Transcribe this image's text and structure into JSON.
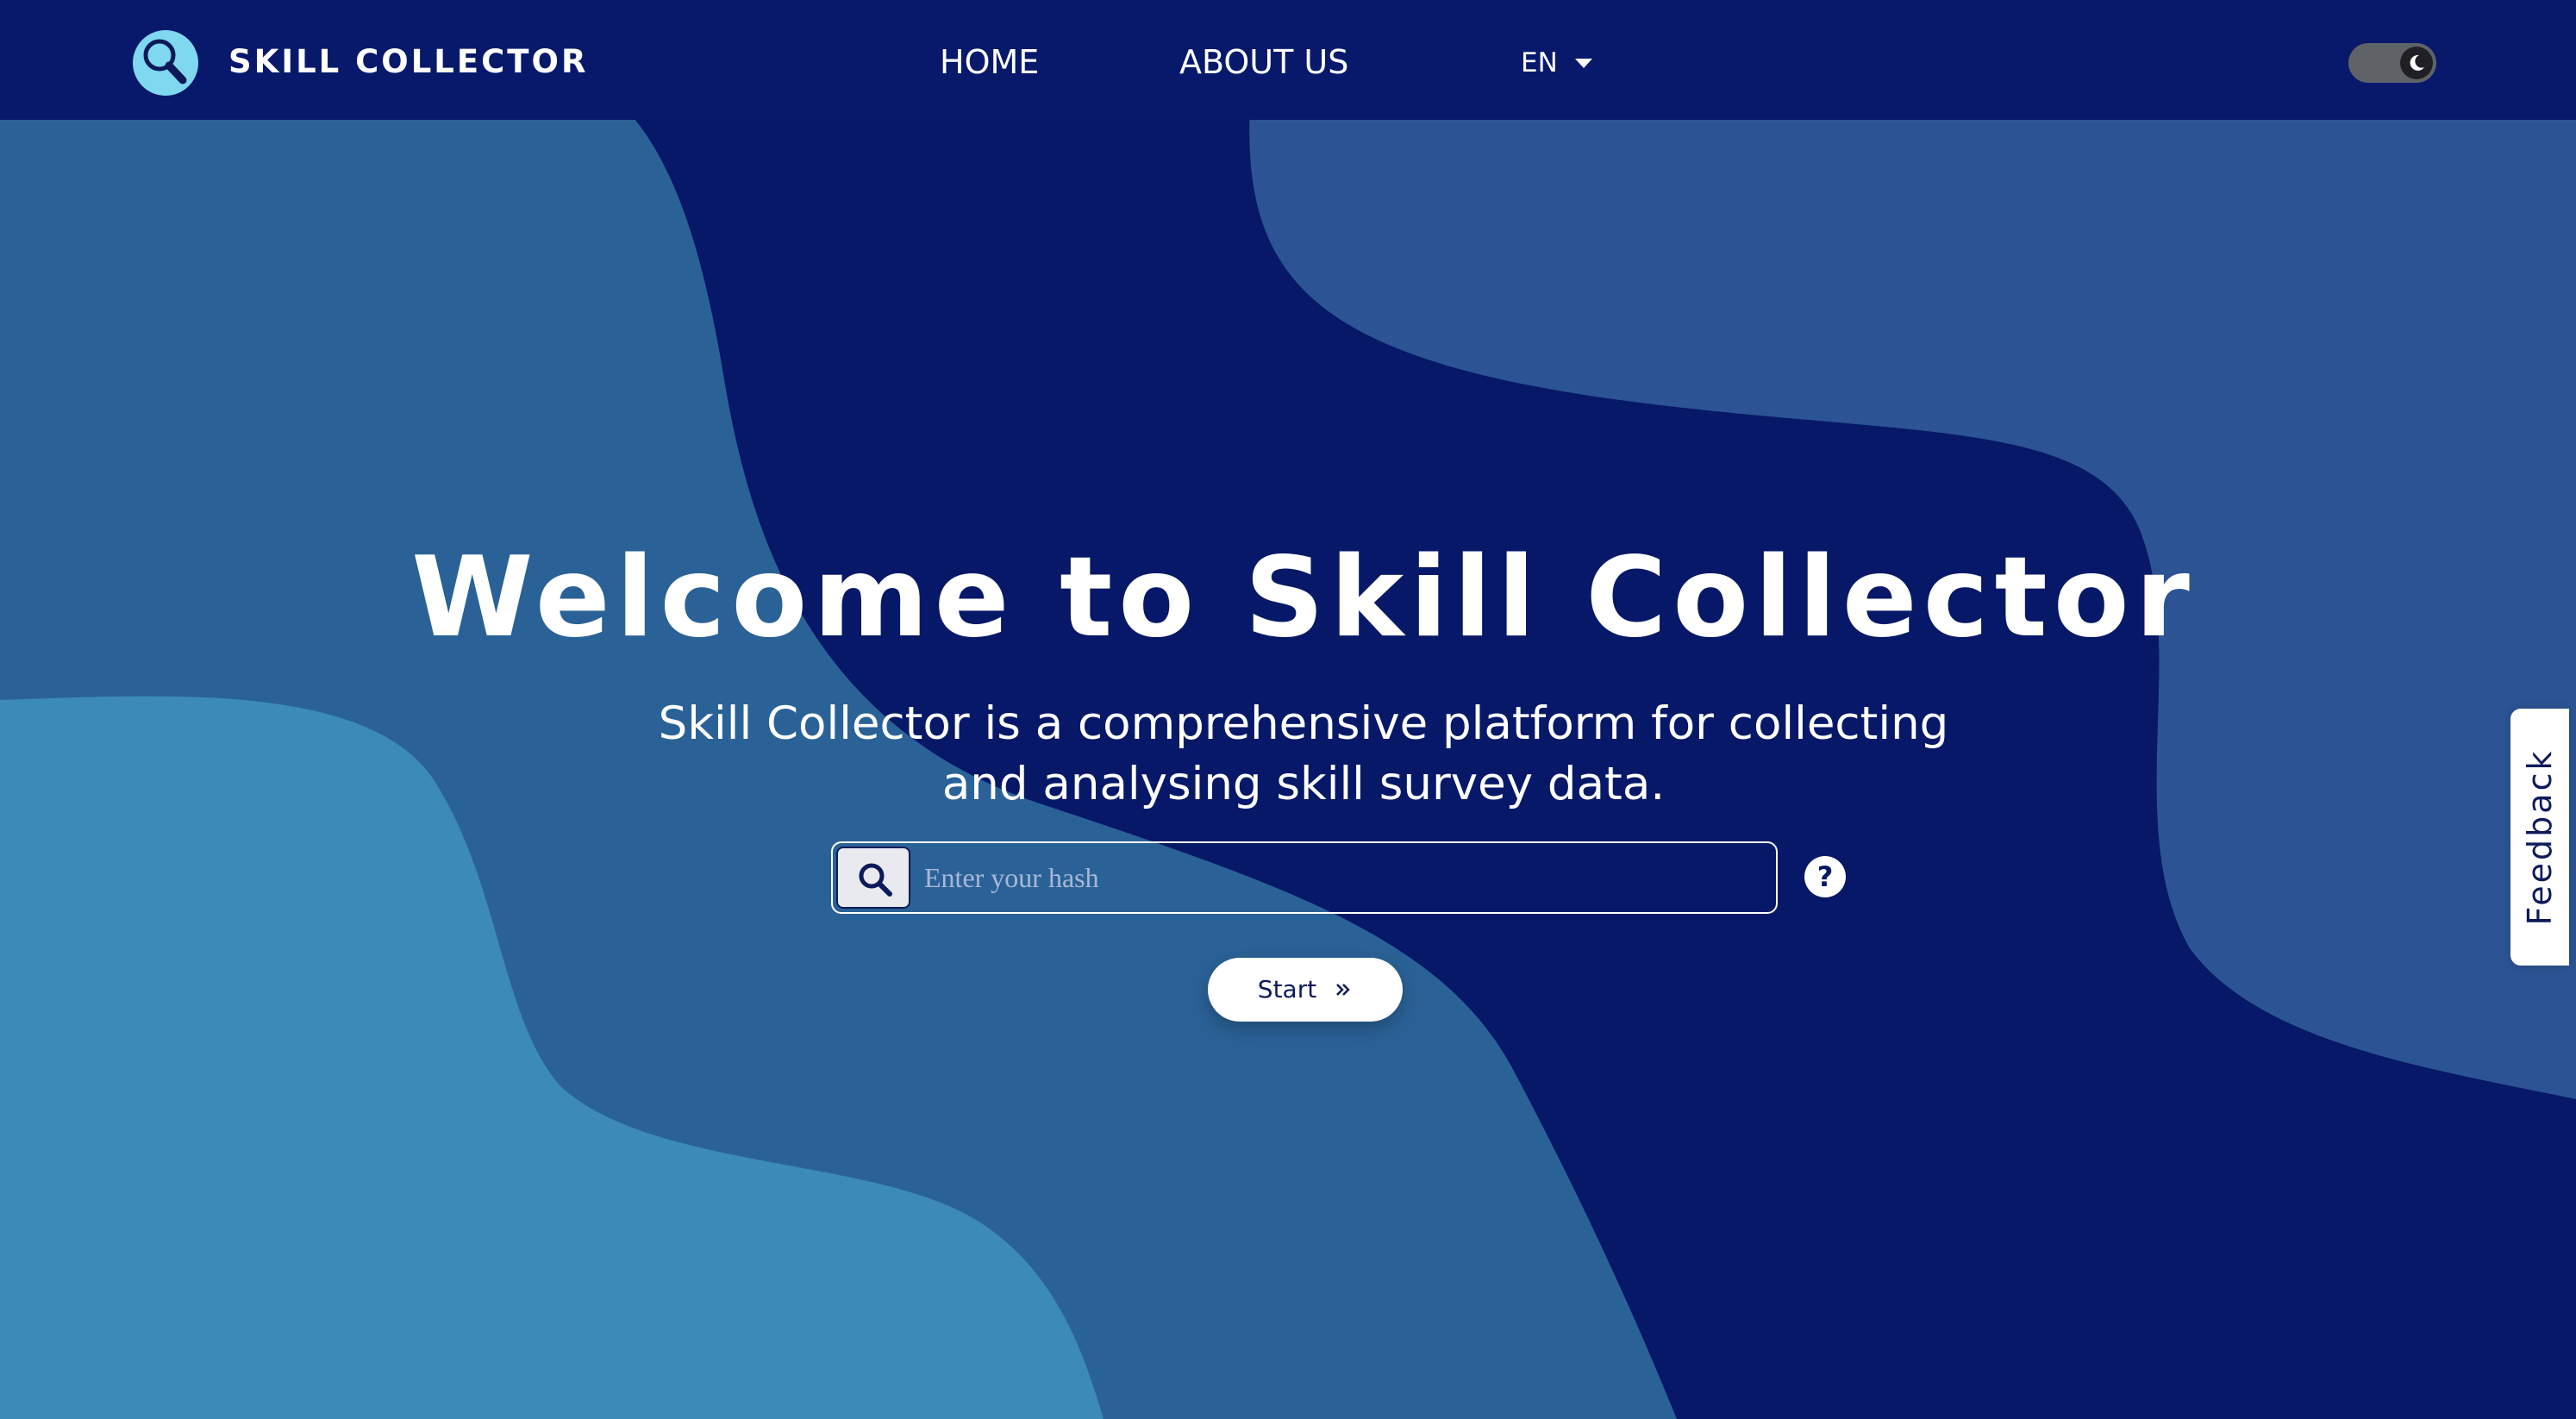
{
  "header": {
    "brand": "SKILL COLLECTOR",
    "logo_icon": "magnifier-logo-icon",
    "nav": [
      {
        "label": "HOME"
      },
      {
        "label": "ABOUT US"
      }
    ],
    "language": {
      "selected": "EN"
    },
    "theme_toggle": {
      "icon": "moon-icon",
      "state": "dark"
    }
  },
  "hero": {
    "title": "Welcome to Skill Collector",
    "subtitle_line1": "Skill Collector is a comprehensive platform for collecting",
    "subtitle_line2": "and analysing skill survey data.",
    "search": {
      "icon": "search-icon",
      "placeholder": "Enter your hash",
      "value": ""
    },
    "help_icon": "question-circle-icon",
    "start_label": "Start",
    "start_icon": "double-chevron-right-icon"
  },
  "feedback": {
    "label": "Feedback"
  },
  "colors": {
    "navbar": "#08196b",
    "background_dark": "#061867",
    "wave_mid": "#2a6297",
    "wave_light": "#3c8ab8",
    "wave_right": "#2c5494",
    "logo_accent": "#7fd8f0",
    "text_dark": "#0d1a5a"
  }
}
